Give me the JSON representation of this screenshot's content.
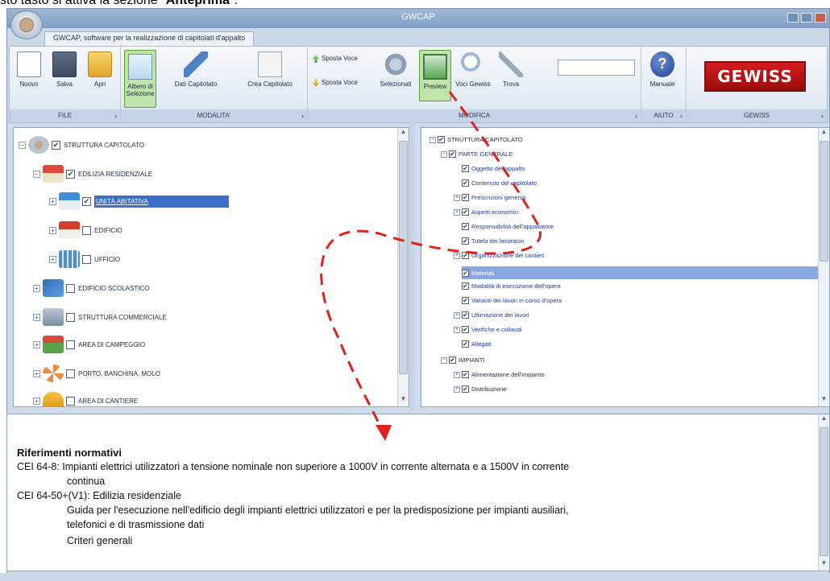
{
  "caption": {
    "prefix": "sto tasto si attiva la sezione \"",
    "bold": "Anteprima",
    "suffix": "\"."
  },
  "window": {
    "title": "GWCAP"
  },
  "ribbon_tab": {
    "label": "GWCAP, software per la realizzazione di capitolati d'appalto"
  },
  "groups": {
    "file": {
      "label": "FILE",
      "buttons": [
        "Nuovo",
        "Salva",
        "Apri"
      ]
    },
    "modalita": {
      "label": "MODALITA'",
      "albero_1": "Albero di",
      "albero_2": "Selezione",
      "dati": "Dati Capitolato",
      "crea": "Crea Capitolato"
    },
    "modifica": {
      "label": "MODIFICA",
      "sposta_up": "Sposta Voce",
      "sposta_down": "Sposta Voce",
      "selezionati": "Selezionati",
      "preview": "Preview",
      "voci": "Voci Gewiss",
      "trova": "Trova"
    },
    "aiuto": {
      "label": "AIUTO",
      "manuale": "Manuale"
    },
    "gewiss": {
      "label": "GEWISS",
      "logo": "GEWISS"
    }
  },
  "left_tree": {
    "root": "STRUTTURA CAPITOLATO",
    "edilizia": "EDILIZIA RESIDENZIALE",
    "unita": "UNITÀ ABITATIVA",
    "edificio": "EDIFICIO",
    "ufficio": "UFFICIO",
    "scolastico": "EDIFICIO SCOLASTICO",
    "commerciale": "STRUTTURA COMMERCIALE",
    "campeggio": "AREA DI CAMPEGGIO",
    "porto": "PORTO, BANCHINA, MOLO",
    "cantiere": "AREA DI CANTIERE"
  },
  "right_tree": {
    "root": "STRUTTURA CAPITOLATO",
    "parte": "PARTE GENERALE",
    "items": [
      "Oggetto dell'appalto",
      "Contenuto del capitolato",
      "Prescrizioni generali",
      "Aspetti economici",
      "Responsabilità dell'appaltatore",
      "Tutela dei lavoratori",
      "Organizzazione dei cantieri",
      "Materiali",
      "Modalità di esecuzione dell'opera",
      "Varianti dei lavori in corso d'opera",
      "Ultimazione dei lavori",
      "Verifiche e collaudi",
      "Allegati"
    ],
    "impianti": "IMPIANTI",
    "alimentazione": "Alimentazione dell'impianto",
    "distribuzione": "Distribuzione"
  },
  "info": {
    "heading": "Riferimenti normativi",
    "l1": "CEI 64-8: Impianti elettrici utilizzatori a tensione nominale non superiore a 1000V in corrente alternata e a 1500V in corrente",
    "l2": "continua",
    "l3": "CEI 64-50+(V1): Edilizia residenziale",
    "l4": "Guida per l'esecuzione nell'edificio degli impianti elettrici utilizzatori e per la predisposizione per impianti ausiliari,",
    "l5": "telefonici e di trasmissione dati",
    "l6": "Criteri generali"
  },
  "colors": {
    "accent": "#3b6fc7",
    "annotation": "#e0221b",
    "gewiss": "#c8171b"
  }
}
